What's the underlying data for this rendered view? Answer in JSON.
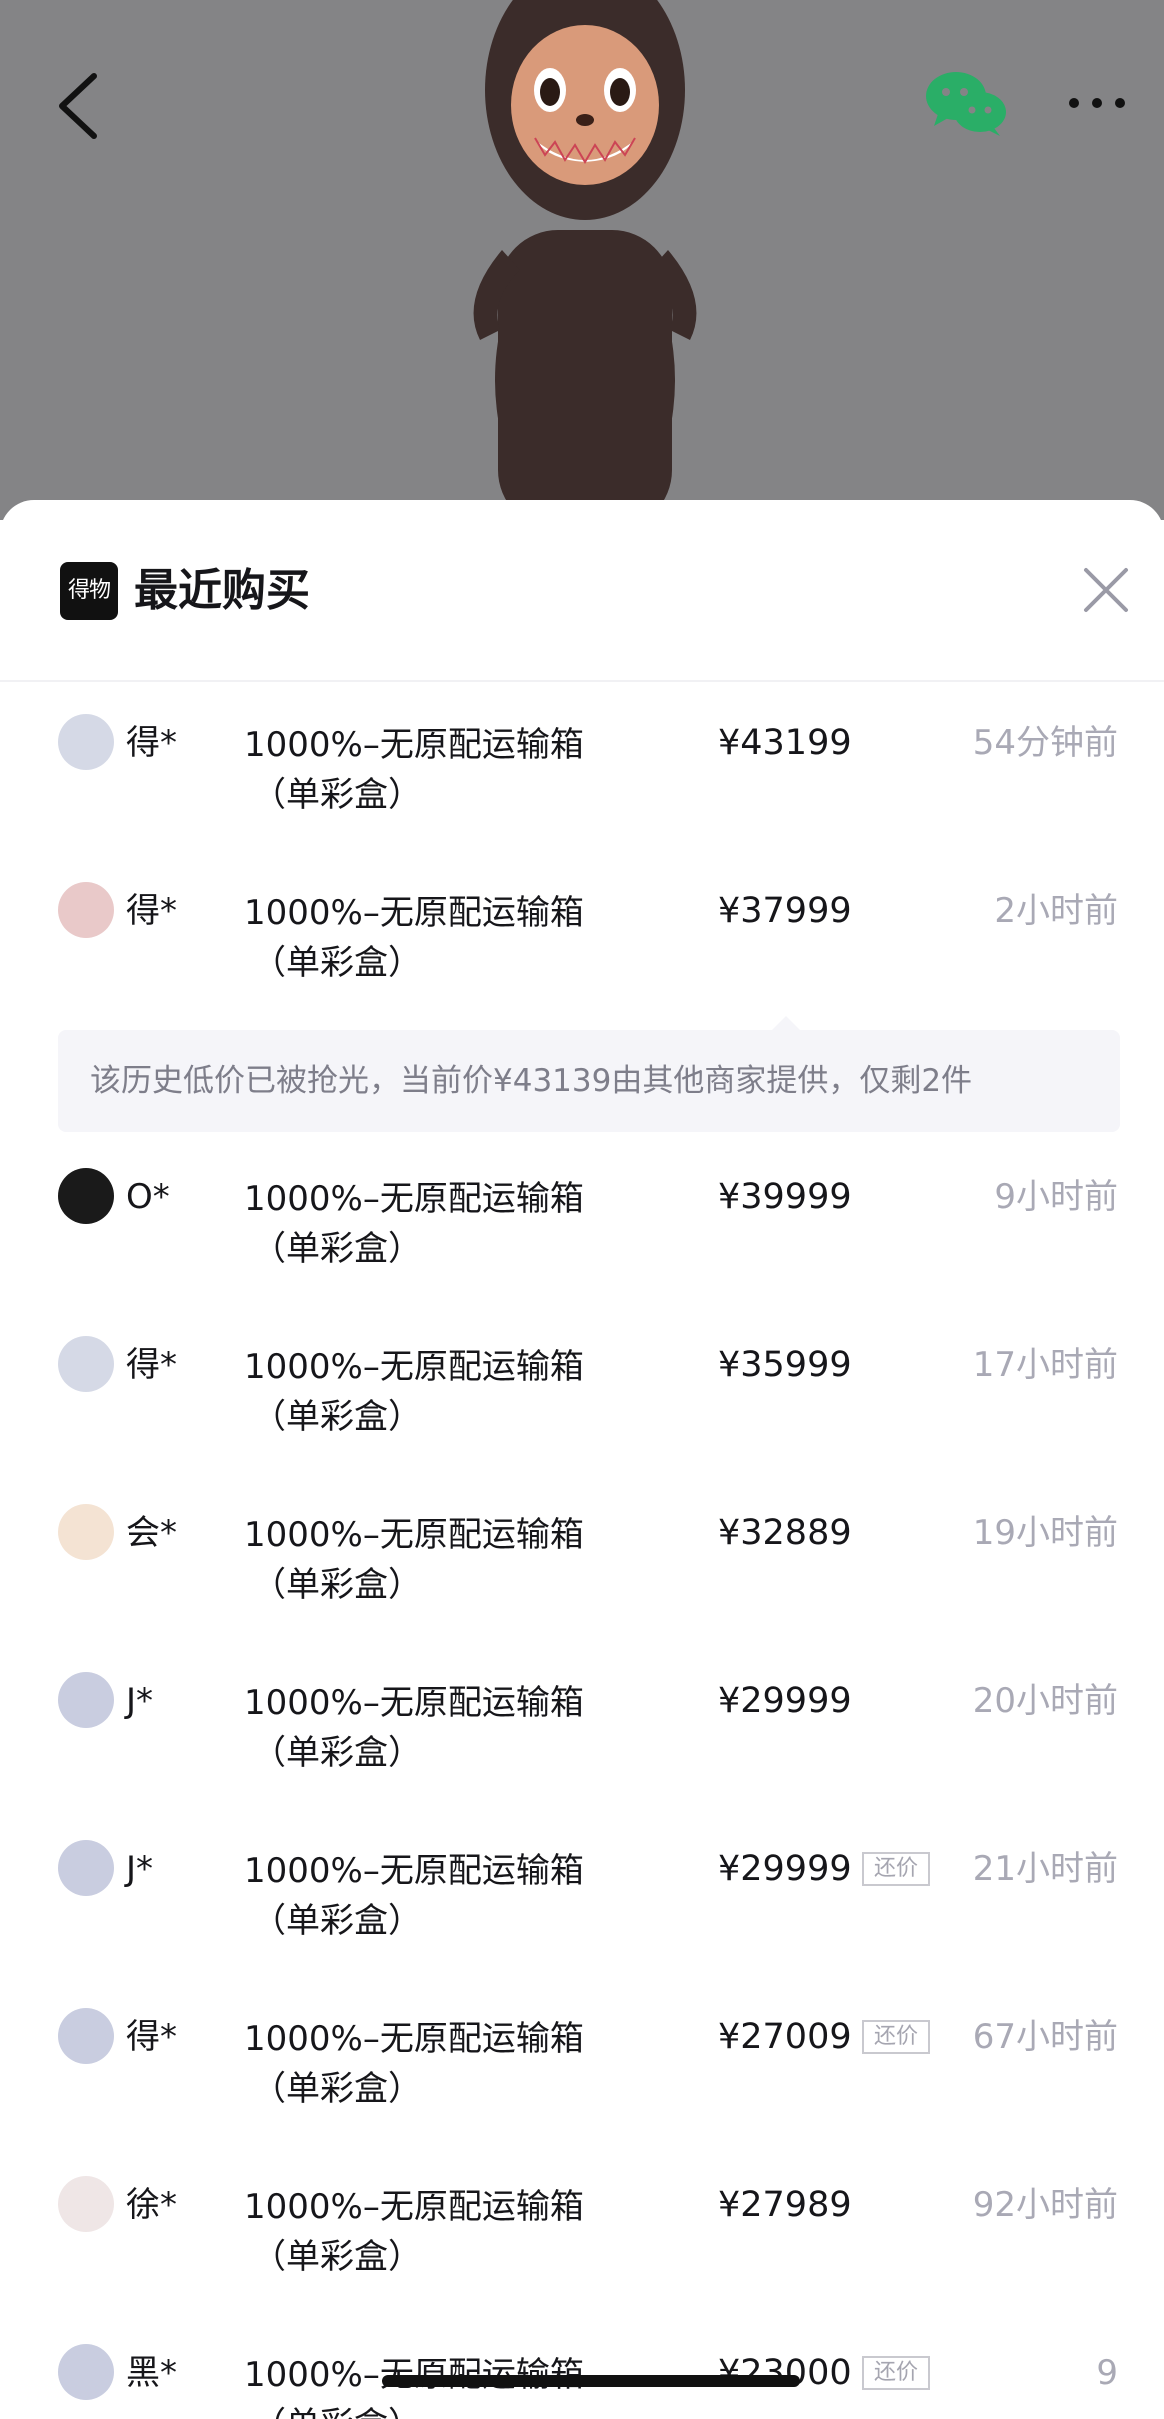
{
  "sheet": {
    "logo_text": "得物",
    "title": "最近购买"
  },
  "purchases": [
    {
      "user": "得*",
      "product_line1": "1000%–无原配运输箱",
      "product_line2": "（单彩盒）",
      "price": "¥43199",
      "tag": "",
      "ago": "54分钟前",
      "avatar_color": "#d5d9e6"
    },
    {
      "user": "得*",
      "product_line1": "1000%–无原配运输箱",
      "product_line2": "（单彩盒）",
      "price": "¥37999",
      "tag": "",
      "ago": "2小时前",
      "avatar_color": "#e9c9c9"
    },
    {
      "user": "O*",
      "product_line1": "1000%–无原配运输箱",
      "product_line2": "（单彩盒）",
      "price": "¥39999",
      "tag": "",
      "ago": "9小时前",
      "avatar_color": "#1a1a1a"
    },
    {
      "user": "得*",
      "product_line1": "1000%–无原配运输箱",
      "product_line2": "（单彩盒）",
      "price": "¥35999",
      "tag": "",
      "ago": "17小时前",
      "avatar_color": "#d5d9e6"
    },
    {
      "user": "会*",
      "product_line1": "1000%–无原配运输箱",
      "product_line2": "（单彩盒）",
      "price": "¥32889",
      "tag": "",
      "ago": "19小时前",
      "avatar_color": "#f4e3d3"
    },
    {
      "user": "J*",
      "product_line1": "1000%–无原配运输箱",
      "product_line2": "（单彩盒）",
      "price": "¥29999",
      "tag": "",
      "ago": "20小时前",
      "avatar_color": "#c9cde0"
    },
    {
      "user": "J*",
      "product_line1": "1000%–无原配运输箱",
      "product_line2": "（单彩盒）",
      "price": "¥29999",
      "tag": "还价",
      "ago": "21小时前",
      "avatar_color": "#c9cde0"
    },
    {
      "user": "得*",
      "product_line1": "1000%–无原配运输箱",
      "product_line2": "（单彩盒）",
      "price": "¥27009",
      "tag": "还价",
      "ago": "67小时前",
      "avatar_color": "#c9cde0"
    },
    {
      "user": "徐*",
      "product_line1": "1000%–无原配运输箱",
      "product_line2": "（单彩盒）",
      "price": "¥27989",
      "tag": "",
      "ago": "92小时前",
      "avatar_color": "#efe6e6"
    },
    {
      "user": "黑*",
      "product_line1": "1000%–无原配运输箱",
      "product_line2": "（单彩盒）",
      "price": "¥23000",
      "tag": "还价",
      "ago": "9",
      "avatar_color": "#c9cde0"
    }
  ],
  "notice": {
    "text": "该历史低价已被抢光，当前价¥43139由其他商家提供，仅剩2件"
  },
  "colors": {
    "hero_overlay": "#848486",
    "accent_wechat": "#2aae67",
    "muted_text": "#a9a9b5"
  },
  "icons": {
    "back": "chevron-left-icon",
    "share": "wechat-icon",
    "more": "more-dots-icon",
    "close": "close-icon"
  }
}
